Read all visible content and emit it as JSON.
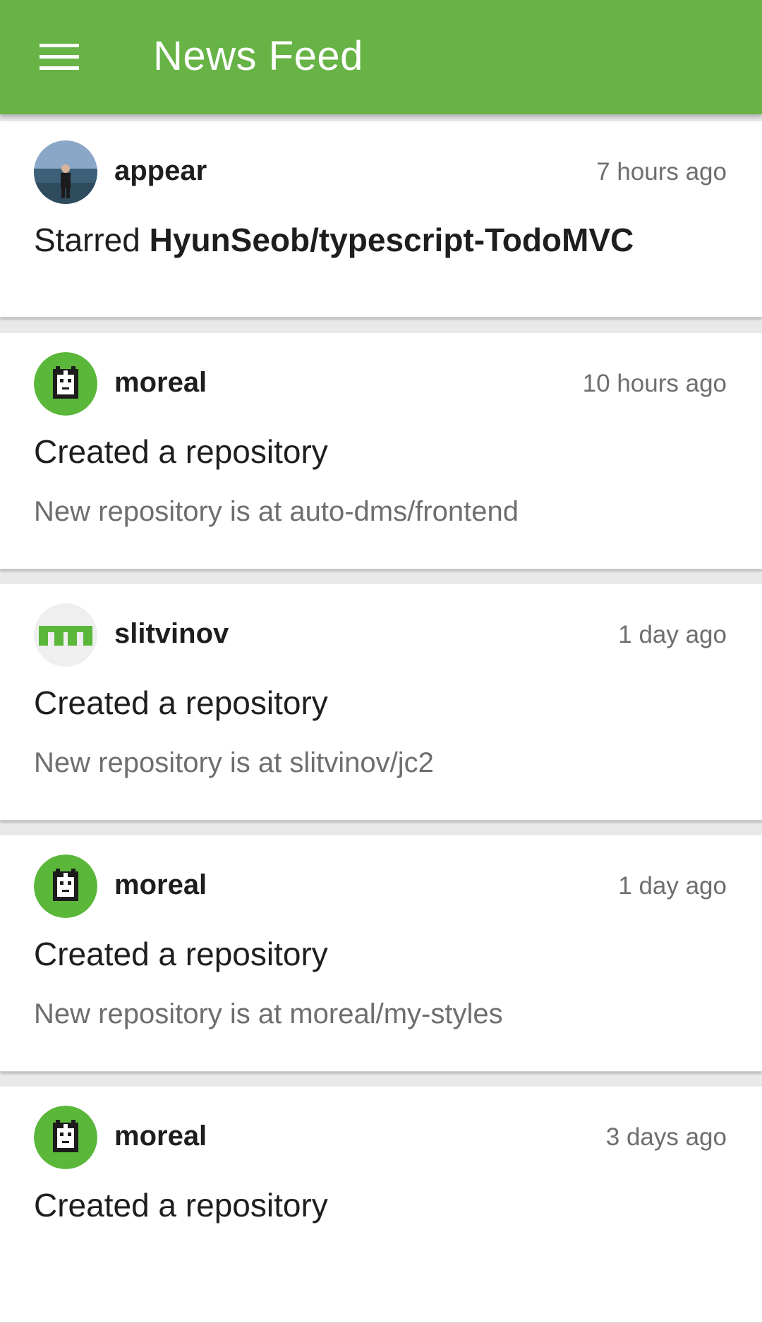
{
  "app_bar": {
    "menu_icon": "hamburger-menu-icon",
    "title": "News Feed",
    "color": "#67b346"
  },
  "feed": {
    "items": [
      {
        "avatar_icon": "user-photo-avatar",
        "username": "appear",
        "time": "7 hours ago",
        "action": "Starred",
        "repo": "HyunSeob/typescript-TodoMVC",
        "detail": ""
      },
      {
        "avatar_icon": "pixel-cat-avatar",
        "username": "moreal",
        "time": "10 hours ago",
        "action": "Created a repository",
        "repo": "",
        "detail": "New repository is at auto-dms/frontend"
      },
      {
        "avatar_icon": "identicon-avatar",
        "username": "slitvinov",
        "time": "1 day ago",
        "action": "Created a repository",
        "repo": "",
        "detail": "New repository is at slitvinov/jc2"
      },
      {
        "avatar_icon": "pixel-cat-avatar",
        "username": "moreal",
        "time": "1 day ago",
        "action": "Created a repository",
        "repo": "",
        "detail": "New repository is at moreal/my-styles"
      },
      {
        "avatar_icon": "pixel-cat-avatar",
        "username": "moreal",
        "time": "3 days ago",
        "action": "Created a repository",
        "repo": "",
        "detail": ""
      }
    ]
  }
}
